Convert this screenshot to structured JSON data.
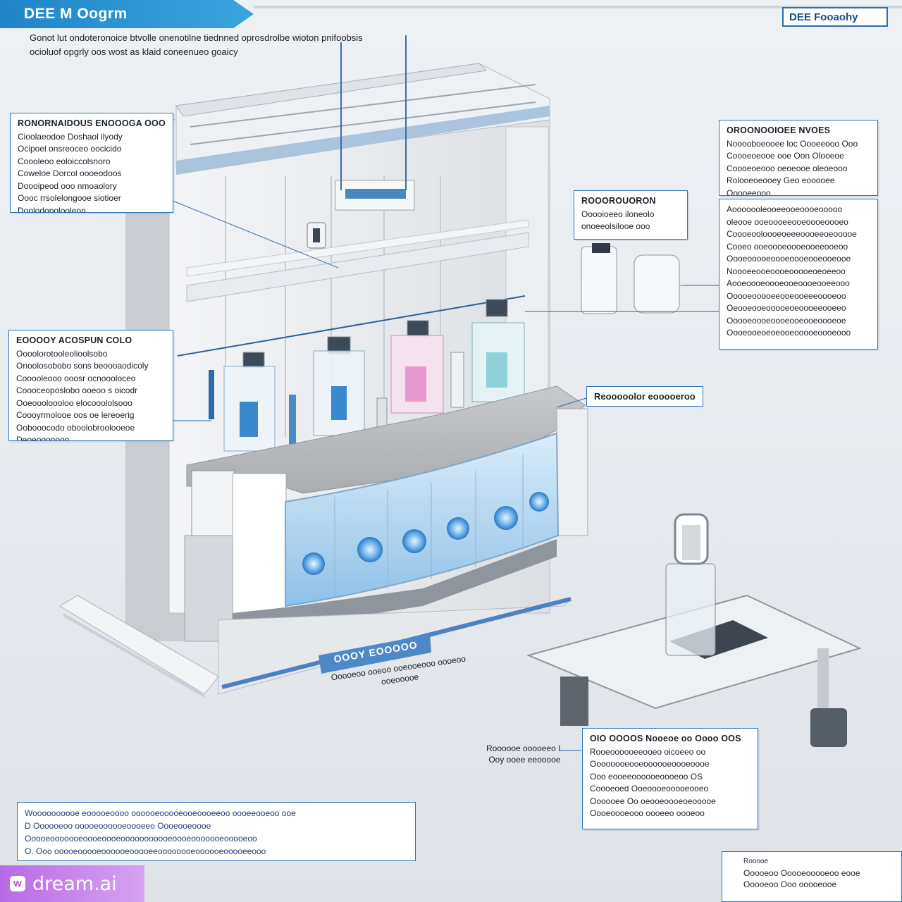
{
  "header": {
    "title": "DEE M Oogrm",
    "brand": "DEE Fooaohy",
    "subtitle_lines": [
      "Gonot lut ondoteronoice btvolle onenotilne tiednned oprosdrolbe wioton pnifoobsis",
      "ocioluof opgrly oos wost as klaid coneenueo goaicy"
    ]
  },
  "callouts": {
    "top_left": {
      "heading": "RONORNAIDOUS ENOOOGA OOO",
      "lines": [
        "Cioolaeodoe Doshaol ilyody",
        "Ocipoel onsreoceo oocicido",
        "Coooleoo eoloiccolsnoro",
        "Coweloe Dorcol oooeodoos",
        "Doooipeod ooo nmoaolory",
        "Oooc rrsolelongooe siotioer",
        "Doolodopolooleon"
      ]
    },
    "mid_left": {
      "heading": "EOOOOY ACOSPUN COLO",
      "lines": [
        "Oooolorotooleolioolsobo",
        "Onoolosobobo sons beoooaodicoly",
        "Cooooleooo ooosr ocnoooloceo",
        "Coooceoposlobo ooeoo s oicodr",
        "Ooeoooloooloo elocooololsooo",
        "Coooyrmolooe oos oe lereoerig",
        "Oobooocodo oboolobroolooeoe",
        "Deoeooonooo"
      ]
    },
    "mid_small": {
      "heading": "ROOOROUORON",
      "lines": [
        "Ooooioeeo iloneolo",
        "onoeeolsilooe ooo"
      ]
    },
    "top_right": {
      "heading": "OROONOOIOEE NVOES",
      "lines": [
        "Nooooboeooee loc Oooeeooo Ooo",
        "Coooeoeooe ooe Oon Olooeoe",
        "Coooeoeooo oeoeooe oleoeooo",
        "Rolooeoeooey Geo eooooee",
        "Ooooeeooo"
      ]
    },
    "right_big": {
      "lines": [
        "Aooooooleooeeooeoooeooooo",
        "oleooe ooeoooeeooeoooeoooeo",
        "Coooeooloooeoeeeoooeeoeooooe",
        "Cooeo ooeoooeoooeooeeooeoo",
        "Oooeooooeoooeoooeooeooeooe",
        "Noooeeooeoooeooooeoeoeeoo",
        "Aooeoooeoooeooeoooeooeeooo",
        "Ooooeooooeeooeooeeeoooeoo",
        "Oeooeooeooooeoeoooeeooeeo",
        "Ooooeoooeoooeooeooeoooeoe",
        "Oooeooeoeoeooeooooeoooeooo"
      ]
    },
    "right_label": {
      "text": "Reooooolor eooooeroo"
    },
    "bottom_right": {
      "heading": "OIO OOOOS Nooeoe oo Oooo OOS",
      "lines": [
        "Rooeoooooeeooeo oicoeeo oo",
        "Oooooooeooeoooooeoooeoooe",
        "Ooo eooeeoooooeoooeoo OS",
        "Coooeoed Ooeoooeooooeooeo",
        "Oooooee Oo oeooeoooeoeooooe",
        "Oooeoooeooo oooeeo oooeoo"
      ]
    },
    "bottom_right_side": {
      "lines": [
        "Roooooe ooooeeo I",
        "Ooy ooee eeooooe"
      ]
    }
  },
  "station": {
    "plate": "OOOY EOOOOO",
    "caption_lines": [
      "Ooooeoo ooeoo ooeooeooo oooeoo",
      "ooeooooe"
    ]
  },
  "bottom_note": {
    "lines": [
      "Woooooooooe eooooeoooo oooooeooooeooeoooeeoo oooeeooeoo ooe",
      "D Oooooeoo ooooeoooooeoooeeo Oooeooeoooe",
      "Ooooeooooooeoooeoooeooooooooooeoooeooooooeooooeoo",
      "O. Ooo ooooeooooeoooooeooooeeoooooooeoooooeooooeeooo"
    ]
  },
  "bottom_right_box": {
    "heading": "Rooooe",
    "lines": [
      "Ooooeoo Ooooeooooeoo eooe",
      "Ooooeoo Ooo ooooeooe"
    ]
  },
  "watermark": {
    "logo_letter": "w",
    "text": "dream.ai"
  },
  "colors": {
    "accent": "#2e73b8",
    "title_blue": "#1f86c9",
    "watermark": "#c07de9"
  }
}
